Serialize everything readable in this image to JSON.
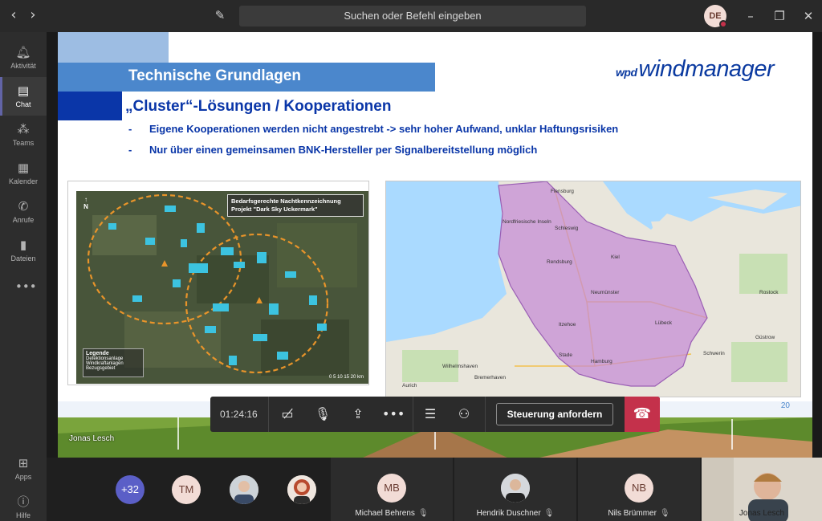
{
  "titlebar": {
    "search_placeholder": "Suchen oder Befehl eingeben",
    "user_initials": "DE",
    "icons": {
      "back": "chevron-left-icon",
      "forward": "chevron-right-icon",
      "compose": "compose-icon",
      "minimize": "minimize-icon",
      "restore": "restore-icon",
      "close": "close-icon"
    }
  },
  "sidebar": {
    "items": [
      {
        "label": "Aktivität",
        "icon": "bell-icon"
      },
      {
        "label": "Chat",
        "icon": "chat-icon",
        "active": true
      },
      {
        "label": "Teams",
        "icon": "teams-icon"
      },
      {
        "label": "Kalender",
        "icon": "calendar-icon"
      },
      {
        "label": "Anrufe",
        "icon": "phone-icon"
      },
      {
        "label": "Dateien",
        "icon": "file-icon"
      }
    ],
    "bottom": [
      {
        "label": "Apps",
        "icon": "apps-icon"
      },
      {
        "label": "Hilfe",
        "icon": "help-icon"
      }
    ]
  },
  "slide": {
    "title": "Technische Grundlagen",
    "brand_small": "wpd",
    "brand": "windmanager",
    "subtitle": "„Cluster“-Lösungen / Kooperationen",
    "bullets": [
      "Eigene Kooperationen werden nicht angestrebt -> sehr hoher Aufwand, unklar Haftungsrisiken",
      "Nur über einen gemeinsamen BNK-Hersteller per Signalbereitstellung möglich"
    ],
    "left_map": {
      "note": "Bedarfsgerechte Nachtkennzeichnung Projekt \"Dark Sky Uckermark\"",
      "north": "N",
      "legend_title": "Legende",
      "legend_items": [
        "Detektionsanlage",
        "Windkraftanlagen",
        "Bezugsgebiet"
      ],
      "scale": "0   5   10   15   20 km"
    },
    "right_map": {
      "labels": [
        "Flensburg",
        "Schleswig",
        "Nordfriesische Inseln",
        "Rendsburg",
        "Kiel",
        "Neumünster",
        "Lübeck",
        "Itzehoe",
        "Hamburg",
        "Stade",
        "Rostock",
        "Schwerin",
        "Wilhelmshaven",
        "Bremerhaven",
        "Güstrow",
        "Aurich"
      ]
    },
    "page_number": "20",
    "presenter": "Jonas Lesch"
  },
  "toolbar": {
    "timer": "01:24:16",
    "control_label": "Steuerung anfordern",
    "icons": [
      "camera-off-icon",
      "mic-off-icon",
      "share-screen-icon",
      "more-icon",
      "meeting-chat-icon",
      "participants-icon",
      "hang-up-icon"
    ]
  },
  "participants": {
    "overflow": "+32",
    "avatars": [
      {
        "initials": "TM"
      }
    ],
    "tiles": [
      {
        "initials": "MB",
        "name": "Michael Behrens"
      },
      {
        "name": "Hendrik Duschner"
      },
      {
        "initials": "NB",
        "name": "Nils Brümmer"
      },
      {
        "name": "Jonas Lesch"
      }
    ]
  },
  "colors": {
    "teams_purple": "#6264a7",
    "hangup_red": "#c4314b",
    "slide_blue": "#0a36a8",
    "coverage_purple": "#c58ad6"
  }
}
